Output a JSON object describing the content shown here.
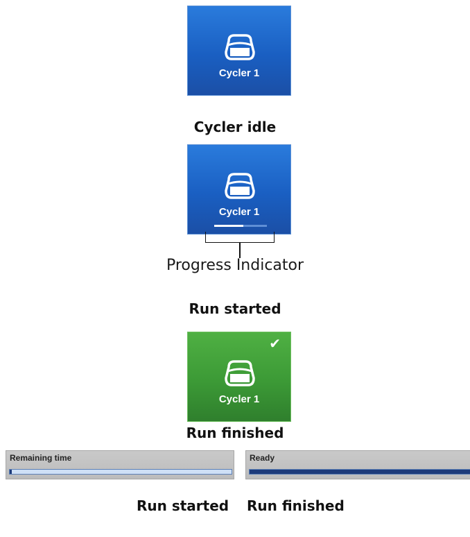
{
  "tiles": [
    {
      "label": "Cycler 1",
      "state": "idle",
      "color": "#1a5fc2",
      "icon": "cycler-icon"
    },
    {
      "label": "Cycler 1",
      "state": "running",
      "color": "#1a5fc2",
      "icon": "cycler-icon",
      "progress": 0.55
    },
    {
      "label": "Cycler 1",
      "state": "finished",
      "color": "#3c9a36",
      "icon": "cycler-icon",
      "badge": "✔"
    }
  ],
  "captions": {
    "idle": "Cycler idle",
    "started": "Run started",
    "finished": "Run finished"
  },
  "annotation": "Progress Indicator",
  "status_bars": [
    {
      "text": "Remaining time",
      "progress": 0.01
    },
    {
      "text": "Ready",
      "progress": 1.0
    }
  ],
  "bottom_captions": [
    "Run started",
    "Run finished"
  ]
}
